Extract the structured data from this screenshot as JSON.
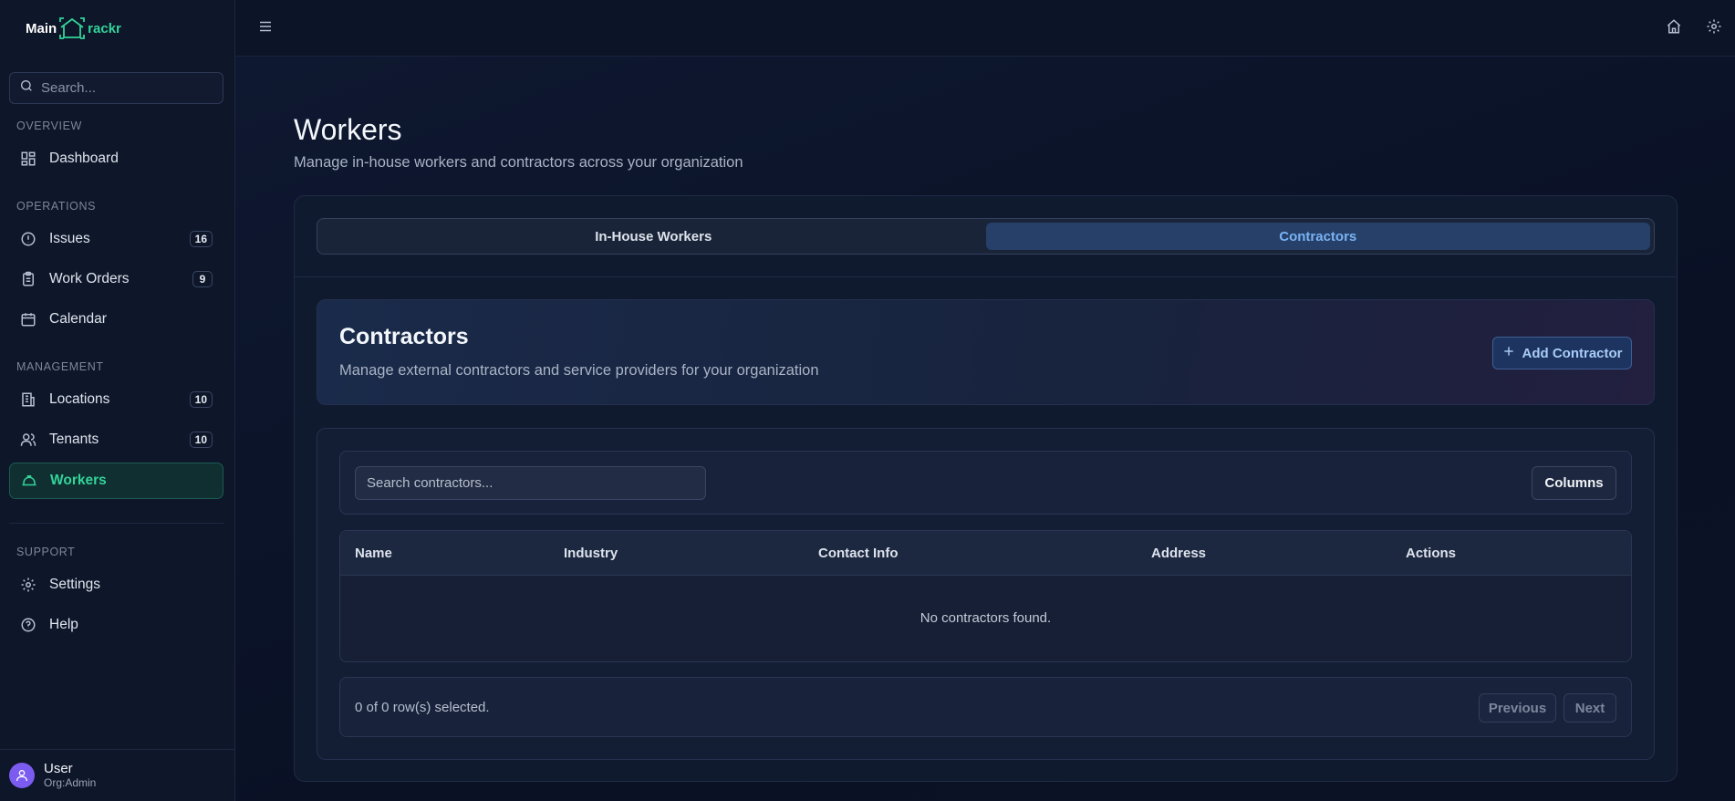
{
  "app": {
    "logo_left": "Main",
    "logo_right": "rackr"
  },
  "sidebar": {
    "search_placeholder": "Search...",
    "sections": {
      "overview": "OVERVIEW",
      "operations": "OPERATIONS",
      "management": "MANAGEMENT",
      "support": "SUPPORT"
    },
    "items": {
      "dashboard": {
        "label": "Dashboard"
      },
      "issues": {
        "label": "Issues",
        "badge": "16"
      },
      "work_orders": {
        "label": "Work Orders",
        "badge": "9"
      },
      "calendar": {
        "label": "Calendar"
      },
      "locations": {
        "label": "Locations",
        "badge": "10"
      },
      "tenants": {
        "label": "Tenants",
        "badge": "10"
      },
      "workers": {
        "label": "Workers"
      },
      "settings": {
        "label": "Settings"
      },
      "help": {
        "label": "Help"
      }
    },
    "user": {
      "name": "User",
      "org": "Org:Admin"
    }
  },
  "page": {
    "title": "Workers",
    "subtitle": "Manage in-house workers and contractors across your organization"
  },
  "tabs": {
    "in_house": "In-House Workers",
    "contractors": "Contractors"
  },
  "hero": {
    "title": "Contractors",
    "subtitle": "Manage external contractors and service providers for your organization",
    "add_button": "Add Contractor"
  },
  "table": {
    "search_placeholder": "Search contractors...",
    "columns_button": "Columns",
    "headers": {
      "name": "Name",
      "industry": "Industry",
      "contact": "Contact Info",
      "address": "Address",
      "actions": "Actions"
    },
    "empty_message": "No contractors found.",
    "selection_text": "0 of 0 row(s) selected.",
    "prev_label": "Previous",
    "next_label": "Next"
  },
  "colors": {
    "accent": "#34d399",
    "tab_active": "#26406a",
    "avatar": "#7c5cf0"
  }
}
